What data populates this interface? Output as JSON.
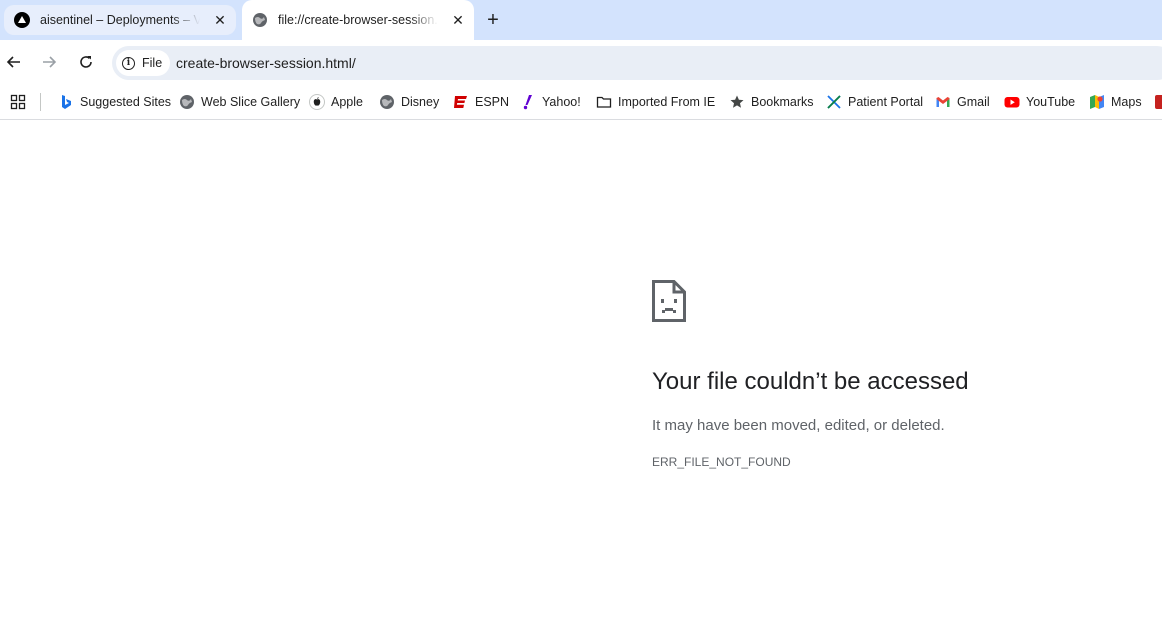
{
  "tabs": [
    {
      "title": "aisentinel – Deployments – Vercel",
      "favicon": "vercel-icon",
      "active": false
    },
    {
      "title": "file://create-browser-session.html/",
      "favicon": "globe-icon",
      "active": true
    }
  ],
  "toolbar": {
    "chip_label": "File",
    "url": "create-browser-session.html/"
  },
  "bookmarks": [
    {
      "label": "Suggested Sites",
      "icon": "bing-icon"
    },
    {
      "label": "Web Slice Gallery",
      "icon": "globe-icon"
    },
    {
      "label": "Apple",
      "icon": "apple-icon"
    },
    {
      "label": "Disney",
      "icon": "globe-icon"
    },
    {
      "label": "ESPN",
      "icon": "espn-icon"
    },
    {
      "label": "Yahoo!",
      "icon": "yahoo-icon"
    },
    {
      "label": "Imported From IE",
      "icon": "folder-icon"
    },
    {
      "label": "Bookmarks",
      "icon": "star-icon"
    },
    {
      "label": "Patient Portal",
      "icon": "x-icon"
    },
    {
      "label": "Gmail",
      "icon": "gmail-icon"
    },
    {
      "label": "YouTube",
      "icon": "youtube-icon"
    },
    {
      "label": "Maps",
      "icon": "maps-icon"
    }
  ],
  "error": {
    "title": "Your file couldn’t be accessed",
    "description": "It may have been moved, edited, or deleted.",
    "code": "ERR_FILE_NOT_FOUND"
  },
  "colors": {
    "tabstrip": "#d3e3fd",
    "omnibox": "#e9eef6",
    "espn": "#d00000",
    "yahoo": "#6001d2",
    "youtube": "#ff0000"
  }
}
